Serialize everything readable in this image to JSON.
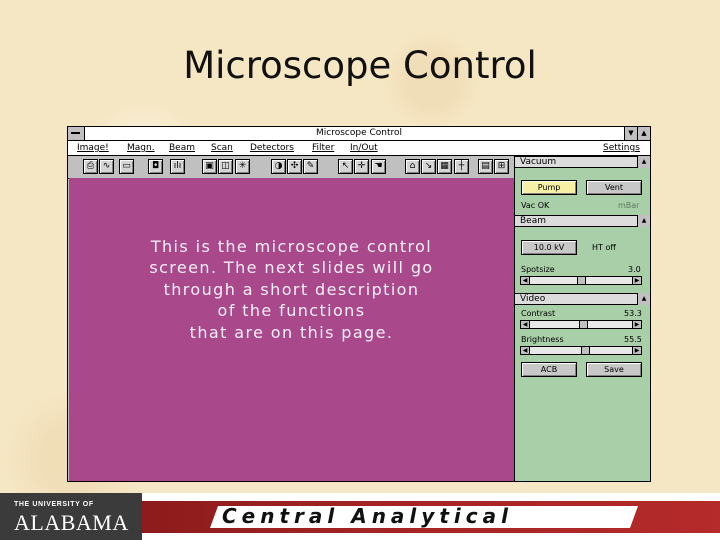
{
  "slide": {
    "title": "Microscope Control"
  },
  "window": {
    "title": "Microscope Control",
    "menus": [
      "Image!",
      "Magn.",
      "Beam",
      "Scan",
      "Detectors",
      "Filter",
      "In/Out"
    ],
    "settings_menu": "Settings"
  },
  "toolbar": {
    "buttons": [
      "printer-icon",
      "waveform-icon",
      "keyboard-icon",
      "camera-icon",
      "histogram-icon",
      "monitor-icon",
      "split-view-icon",
      "asterisk-icon",
      "circle-icon",
      "crosshair-icon",
      "pencil-icon",
      "pointer-icon",
      "move-icon",
      "hand-icon",
      "home-icon",
      "measure-icon",
      "grid-icon",
      "ruler-icon",
      "page-icon",
      "quad-view-icon"
    ]
  },
  "image_area": {
    "lines": [
      "This is the microscope control",
      "screen.  The next slides will go",
      "through a short description",
      "of the functions",
      "that are on this page."
    ],
    "background": "#a9488b"
  },
  "panel": {
    "vacuum": {
      "header": "Vacuum",
      "pump": "Pump",
      "vent": "Vent",
      "status": "Vac OK",
      "unit": "mBar"
    },
    "beam": {
      "header": "Beam",
      "kv": "10.0 kV",
      "ht": "HT off",
      "spotsize_label": "Spotsize",
      "spotsize_value": "3.0",
      "spotsize_level": 0.5
    },
    "video": {
      "header": "Video",
      "contrast_label": "Contrast",
      "contrast_value": "53.3",
      "contrast_level": 0.53,
      "brightness_label": "Brightness",
      "brightness_value": "55.5",
      "brightness_level": 0.55,
      "acb": "ACB",
      "save": "Save"
    },
    "background": "#a8cfa8"
  },
  "footer": {
    "univ_small": "THE UNIVERSITY OF",
    "univ_big": "ALABAMA",
    "dept": "Central Analytical"
  }
}
